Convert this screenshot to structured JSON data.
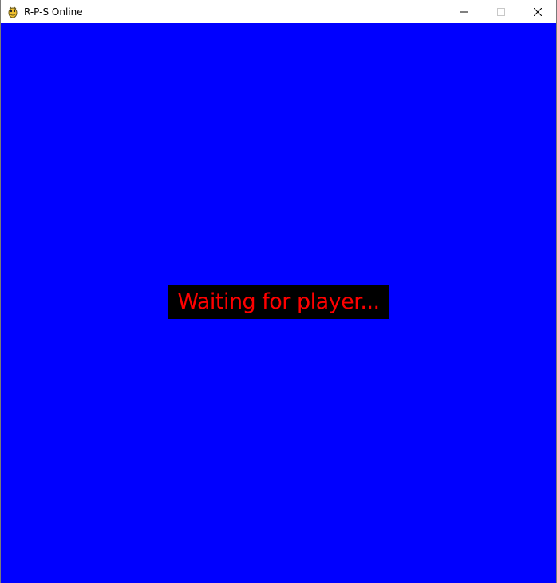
{
  "window": {
    "title": "R-P-S Online",
    "icon": "pygame-snake-icon"
  },
  "caption_buttons": {
    "minimize": "minimize-icon",
    "maximize": "maximize-icon",
    "close": "close-icon"
  },
  "game": {
    "background_color": "#0000ff",
    "status_text": "Waiting for player...",
    "status_text_color": "#ff0000",
    "status_box_color": "#000000"
  }
}
